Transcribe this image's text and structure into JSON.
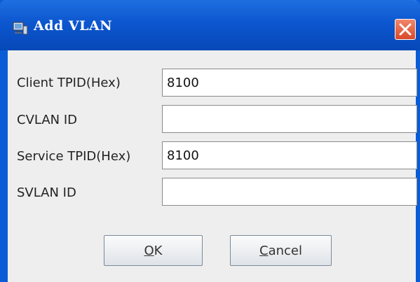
{
  "window": {
    "title": "Add VLAN",
    "app_icon": "monitor-icon",
    "close_icon": "close-icon",
    "colors": {
      "titlebar": "#0c56cf",
      "close": "#d9482a",
      "body": "#eeeeee"
    }
  },
  "form": {
    "client_tpid": {
      "label": "Client TPID(Hex)",
      "value": "8100"
    },
    "cvlan_id": {
      "label": "CVLAN ID",
      "value": ""
    },
    "service_tpid": {
      "label": "Service TPID(Hex)",
      "value": "8100"
    },
    "svlan_id": {
      "label": "SVLAN ID",
      "value": ""
    }
  },
  "buttons": {
    "ok": {
      "mnemonic": "O",
      "rest": "K"
    },
    "cancel": {
      "mnemonic": "C",
      "rest": "ancel"
    }
  }
}
